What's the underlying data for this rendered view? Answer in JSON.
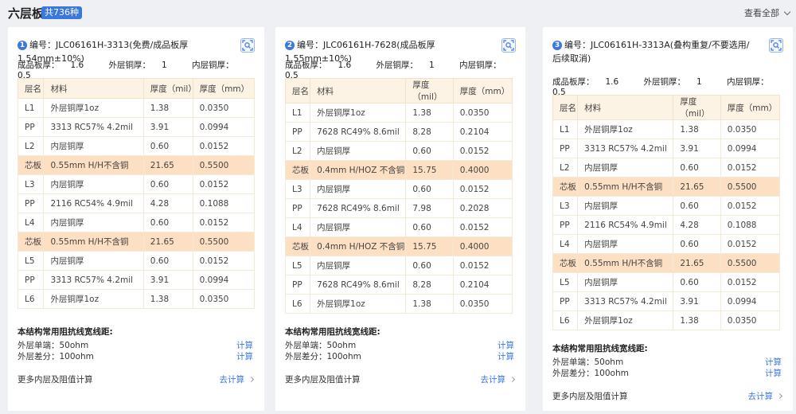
{
  "header": {
    "title": "六层板",
    "count": "共736种",
    "view_all": "查看全部"
  },
  "table_headers": [
    "层名",
    "材料",
    "厚度（mil）",
    "厚度（mm）"
  ],
  "spec_labels": {
    "finished": "成品板厚：",
    "outer": "外层铜厚：",
    "inner": "内层铜厚："
  },
  "impedance_title": "本结构常用阻抗线宽线距:",
  "more_label": "更多内层及阻值计算",
  "go_calc": "去计算",
  "calc": "计算",
  "cards": [
    {
      "num": "1",
      "code": "编号：JLC06161H-3313(免费/成品板厚1.54mm±10%)",
      "finished": "1.6",
      "outer": "1",
      "inner": "0.5",
      "rows": [
        {
          "layer": "L1",
          "material": "外层铜厚1oz",
          "mil": "1.38",
          "mm": "0.0350"
        },
        {
          "layer": "PP",
          "material": "3313 RC57% 4.2mil",
          "mil": "3.91",
          "mm": "0.0994"
        },
        {
          "layer": "L2",
          "material": "内层铜厚",
          "mil": "0.60",
          "mm": "0.0152"
        },
        {
          "layer": "芯板",
          "material": "0.55mm H/H不含铜",
          "mil": "21.65",
          "mm": "0.5500"
        },
        {
          "layer": "L3",
          "material": "内层铜厚",
          "mil": "0.60",
          "mm": "0.0152"
        },
        {
          "layer": "PP",
          "material": "2116 RC54% 4.9mil",
          "mil": "4.28",
          "mm": "0.1088"
        },
        {
          "layer": "L4",
          "material": "内层铜厚",
          "mil": "0.60",
          "mm": "0.0152"
        },
        {
          "layer": "芯板",
          "material": "0.55mm H/H不含铜",
          "mil": "21.65",
          "mm": "0.5500"
        },
        {
          "layer": "L5",
          "material": "内层铜厚",
          "mil": "0.60",
          "mm": "0.0152"
        },
        {
          "layer": "PP",
          "material": "3313 RC57% 4.2mil",
          "mil": "3.91",
          "mm": "0.0994"
        },
        {
          "layer": "L6",
          "material": "外层铜厚1oz",
          "mil": "1.38",
          "mm": "0.0350"
        }
      ],
      "impedance": [
        "外层单端：50ohm",
        "外层差分：100ohm"
      ]
    },
    {
      "num": "2",
      "code": "编号：JLC06161H-7628(成品板厚1.55mm±10%)",
      "finished": "1.6",
      "outer": "1",
      "inner": "0.5",
      "rows": [
        {
          "layer": "L1",
          "material": "外层铜厚1oz",
          "mil": "1.38",
          "mm": "0.0350"
        },
        {
          "layer": "PP",
          "material": "7628 RC49% 8.6mil",
          "mil": "8.28",
          "mm": "0.2104"
        },
        {
          "layer": "L2",
          "material": "内层铜厚",
          "mil": "0.60",
          "mm": "0.0152"
        },
        {
          "layer": "芯板",
          "material": "0.4mm H/HOZ 不含铜",
          "mil": "15.75",
          "mm": "0.4000"
        },
        {
          "layer": "L3",
          "material": "内层铜厚",
          "mil": "0.60",
          "mm": "0.0152"
        },
        {
          "layer": "PP",
          "material": "7628 RC49% 8.6mil",
          "mil": "7.98",
          "mm": "0.2028"
        },
        {
          "layer": "L4",
          "material": "内层铜厚",
          "mil": "0.60",
          "mm": "0.0152"
        },
        {
          "layer": "芯板",
          "material": "0.4mm H/HOZ 不含铜",
          "mil": "15.75",
          "mm": "0.4000"
        },
        {
          "layer": "L5",
          "material": "内层铜厚",
          "mil": "0.60",
          "mm": "0.0152"
        },
        {
          "layer": "PP",
          "material": "7628 RC49% 8.6mil",
          "mil": "8.28",
          "mm": "0.2104"
        },
        {
          "layer": "L6",
          "material": "外层铜厚1oz",
          "mil": "1.38",
          "mm": "0.0350"
        }
      ],
      "impedance": [
        "外层单端：50ohm",
        "外层差分：100ohm"
      ]
    },
    {
      "num": "3",
      "code": "编号：JLC06161H-3313A(叠构重复/不要选用/后续取消)",
      "finished": "1.6",
      "outer": "1",
      "inner": "0.5",
      "rows": [
        {
          "layer": "L1",
          "material": "外层铜厚1oz",
          "mil": "1.38",
          "mm": "0.0350"
        },
        {
          "layer": "PP",
          "material": "3313 RC57% 4.2mil",
          "mil": "3.91",
          "mm": "0.0994"
        },
        {
          "layer": "L2",
          "material": "内层铜厚",
          "mil": "0.60",
          "mm": "0.0152"
        },
        {
          "layer": "芯板",
          "material": "0.55mm H/H不含铜",
          "mil": "21.65",
          "mm": "0.5500"
        },
        {
          "layer": "L3",
          "material": "内层铜厚",
          "mil": "0.60",
          "mm": "0.0152"
        },
        {
          "layer": "PP",
          "material": "2116 RC54% 4.9mil",
          "mil": "4.28",
          "mm": "0.1088"
        },
        {
          "layer": "L4",
          "material": "内层铜厚",
          "mil": "0.60",
          "mm": "0.0152"
        },
        {
          "layer": "芯板",
          "material": "0.55mm H/H不含铜",
          "mil": "21.65",
          "mm": "0.5500"
        },
        {
          "layer": "L5",
          "material": "内层铜厚",
          "mil": "0.60",
          "mm": "0.0152"
        },
        {
          "layer": "PP",
          "material": "3313 RC57% 4.2mil",
          "mil": "3.91",
          "mm": "0.0994"
        },
        {
          "layer": "L6",
          "material": "外层铜厚1oz",
          "mil": "1.38",
          "mm": "0.0350"
        }
      ],
      "impedance": [
        "外层单端：50ohm",
        "外层差分：100ohm"
      ]
    }
  ]
}
